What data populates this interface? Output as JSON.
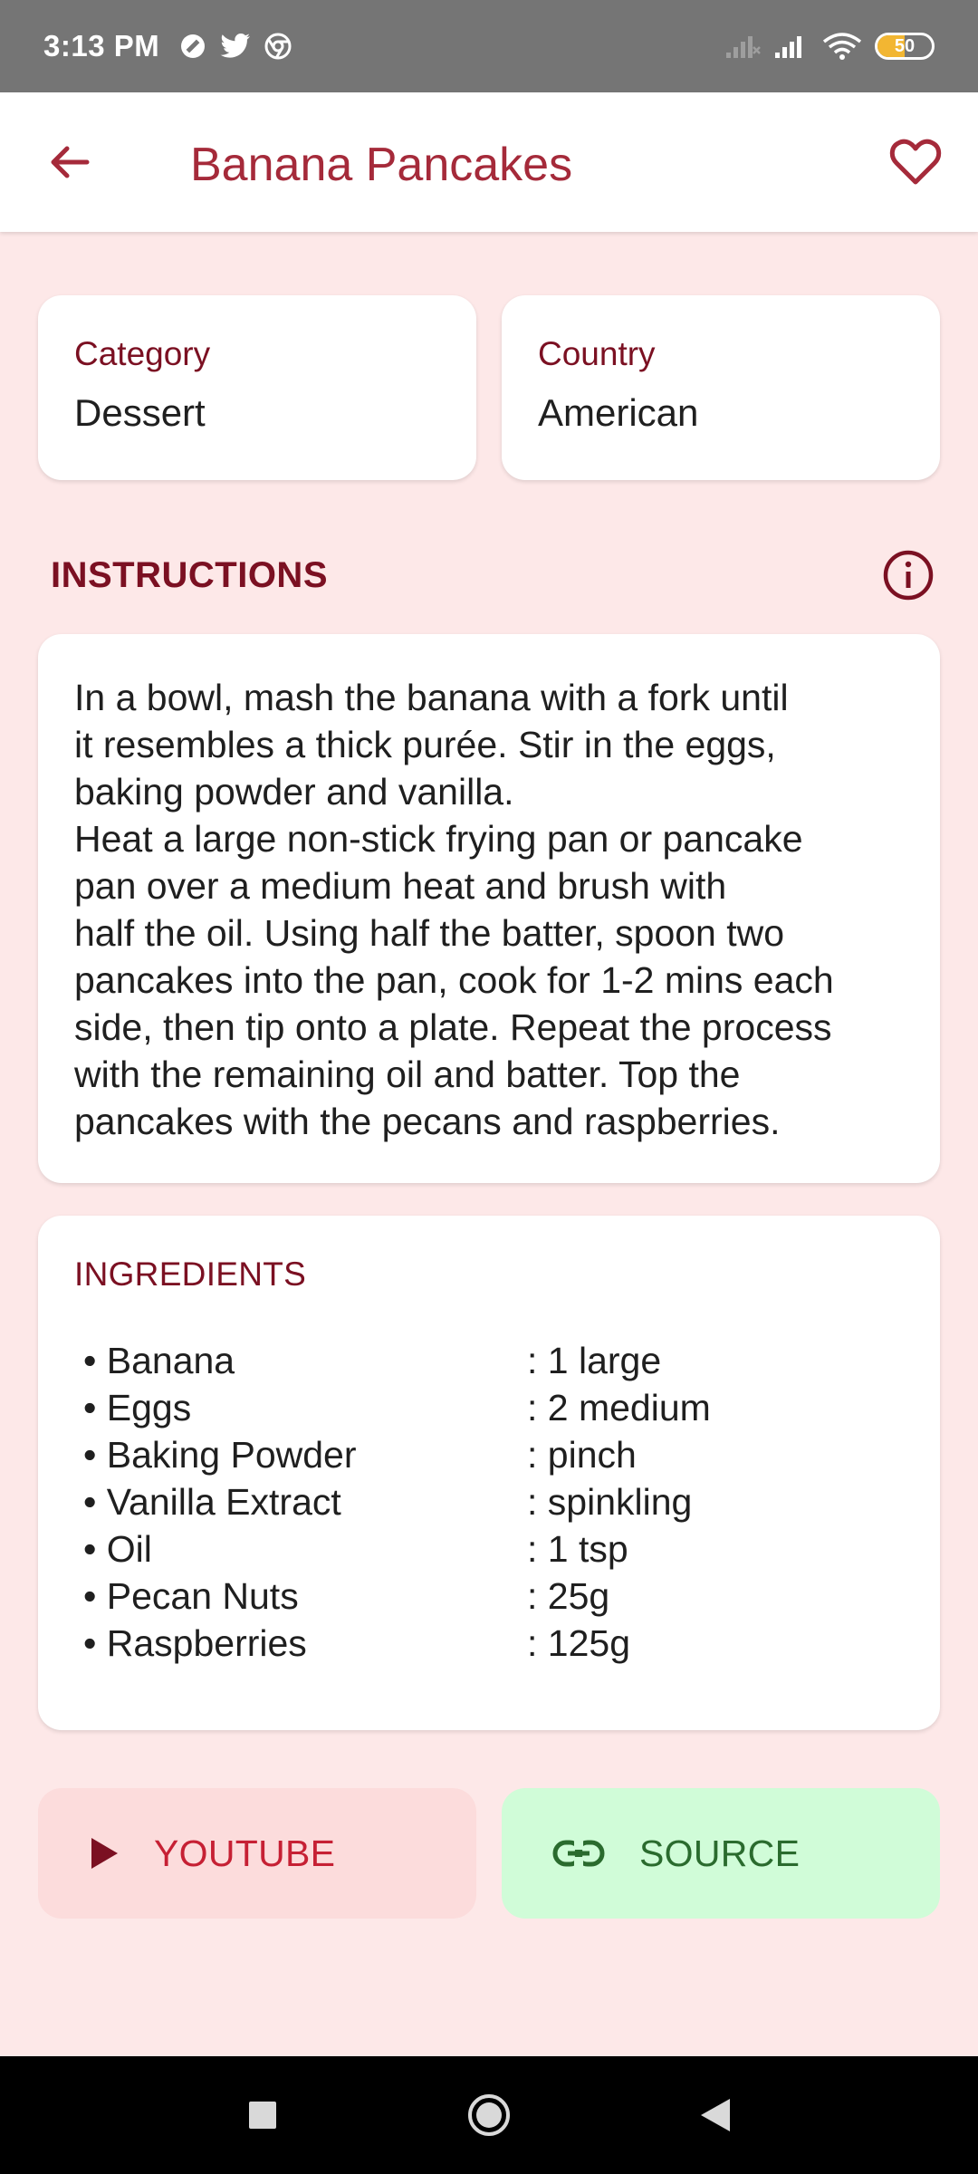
{
  "status_bar": {
    "time": "3:13 PM",
    "battery": "50",
    "battery_level": 0.5,
    "icons": [
      "do-not-disturb-icon",
      "twitter-icon",
      "chrome-icon",
      "signal-off-icon",
      "signal-icon",
      "wifi-icon",
      "battery-icon"
    ]
  },
  "app_bar": {
    "title": "Banana Pancakes",
    "back_icon": "arrow-left-icon",
    "favorite_icon": "heart-outline-icon"
  },
  "info": {
    "category_label": "Category",
    "category_value": "Dessert",
    "country_label": "Country",
    "country_value": "American"
  },
  "instructions": {
    "heading": "INSTRUCTIONS",
    "info_icon": "info-circle-icon",
    "text": "In a bowl, mash the banana with a fork until\nit resembles a thick purée. Stir in the eggs,\nbaking powder and vanilla.\nHeat a large non-stick frying pan or pancake\npan over a medium heat and brush with\nhalf the oil. Using half the batter, spoon two\npancakes into the pan, cook for 1-2 mins each\nside, then tip onto a plate. Repeat the process\nwith the remaining oil and batter. Top the\npancakes with the pecans and raspberries."
  },
  "ingredients": {
    "heading": "INGREDIENTS",
    "items": [
      {
        "name": "• Banana",
        "measure": ": 1 large"
      },
      {
        "name": "• Eggs",
        "measure": ": 2 medium"
      },
      {
        "name": "• Baking Powder",
        "measure": ": pinch"
      },
      {
        "name": "• Vanilla Extract",
        "measure": ": spinkling"
      },
      {
        "name": "• Oil",
        "measure": ": 1 tsp"
      },
      {
        "name": "• Pecan Nuts",
        "measure": ": 25g"
      },
      {
        "name": "• Raspberries",
        "measure": ": 125g"
      }
    ]
  },
  "actions": {
    "youtube_label": "YOUTUBE",
    "youtube_icon": "play-icon",
    "source_label": "SOURCE",
    "source_icon": "link-icon"
  },
  "nav_bar": {
    "items": [
      "recents-square-icon",
      "home-circle-icon",
      "back-triangle-icon"
    ]
  },
  "colors": {
    "background": "#fde8e8",
    "accent": "#a52a3a",
    "heading": "#7b1022",
    "youtube_bg": "#fcdcdc",
    "source_bg": "#d0fcd8"
  }
}
